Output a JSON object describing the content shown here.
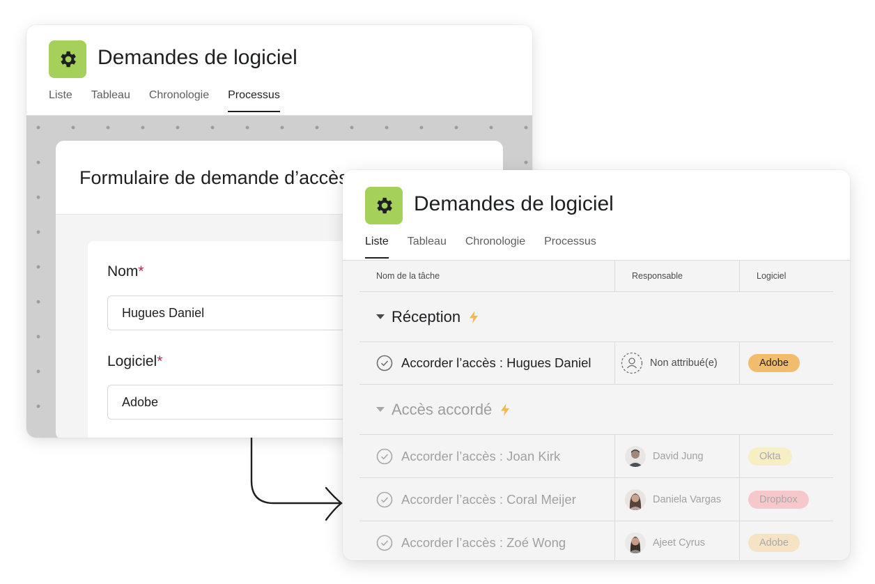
{
  "app_title": "Demandes de logiciel",
  "colors": {
    "app_icon": "#a5d15a",
    "tag_adobe": "#f1bd6c",
    "tag_adobe_muted": "#f5e3c4",
    "tag_okta": "#f6efc4",
    "tag_dropbox": "#f6c8cc",
    "bolt": "#f2b84b"
  },
  "back_card": {
    "title": "Demandes de logiciel",
    "tabs": [
      {
        "label": "Liste",
        "active": false
      },
      {
        "label": "Tableau",
        "active": false
      },
      {
        "label": "Chronologie",
        "active": false
      },
      {
        "label": "Processus",
        "active": true
      }
    ],
    "form": {
      "title": "Formulaire de demande d’accès",
      "fields": [
        {
          "label": "Nom",
          "required_mark": "*",
          "value": "Hugues Daniel"
        },
        {
          "label": "Logiciel",
          "required_mark": "*",
          "value": "Adobe"
        }
      ]
    }
  },
  "front_card": {
    "title": "Demandes de logiciel",
    "tabs": [
      {
        "label": "Liste",
        "active": true
      },
      {
        "label": "Tableau",
        "active": false
      },
      {
        "label": "Chronologie",
        "active": false
      },
      {
        "label": "Processus",
        "active": false
      }
    ],
    "columns": [
      "Nom de la tâche",
      "Responsable",
      "Logiciel"
    ],
    "sections": [
      {
        "name": "Réception",
        "icon": "lightning-bolt-icon",
        "tasks": [
          {
            "name": "Accorder l’accès : Hugues Daniel",
            "assignee": "Non attribué(e)",
            "avatar": "unassigned-icon",
            "software": "Adobe"
          }
        ]
      },
      {
        "name": "Accès accordé",
        "icon": "lightning-bolt-icon",
        "tasks": [
          {
            "name": "Accorder l’accès : Joan Kirk",
            "assignee": "David Jung",
            "avatar": "avatar-photo",
            "software": "Okta"
          },
          {
            "name": "Accorder l’accès : Coral Meijer",
            "assignee": "Daniela Vargas",
            "avatar": "avatar-photo",
            "software": "Dropbox"
          },
          {
            "name": "Accorder l’accès : Zoé Wong",
            "assignee": "Ajeet Cyrus",
            "avatar": "avatar-photo",
            "software": "Adobe"
          }
        ]
      }
    ]
  }
}
